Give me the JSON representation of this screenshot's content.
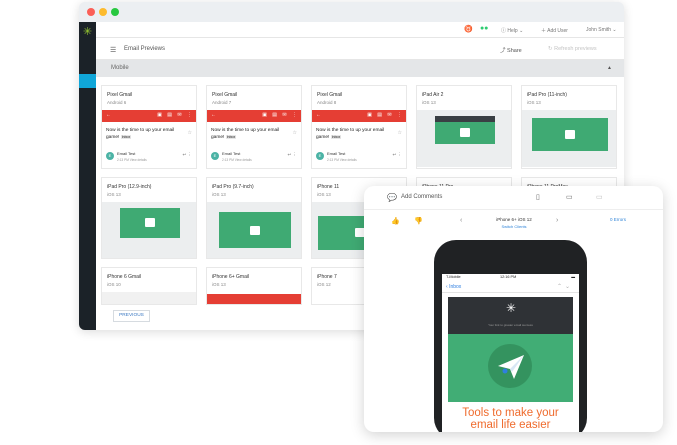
{
  "topbar": {
    "help": "Help",
    "add_user": "Add User",
    "user": "John Smith"
  },
  "header": {
    "title": "Email Previews",
    "share": "Share",
    "refresh": "Refresh previews"
  },
  "section": {
    "label": "Mobile"
  },
  "gmail": {
    "subject": "Now is the time to up your email game!",
    "inbox_tag": "Inbox",
    "from": "Email Test",
    "meta": "2:13 PM View details",
    "avatar_letter": "E"
  },
  "cards": [
    {
      "name": "Pixel Gmail",
      "os": "Android 6"
    },
    {
      "name": "Pixel Gmail",
      "os": "Android 7"
    },
    {
      "name": "Pixel Gmail",
      "os": "Android 8"
    },
    {
      "name": "iPad Air 2",
      "os": "iOS 13"
    },
    {
      "name": "iPad Pro (11-inch)",
      "os": "iOS 13"
    },
    {
      "name": "iPad Pro (12.9-inch)",
      "os": "iOS 13"
    },
    {
      "name": "iPad Pro (9.7-inch)",
      "os": "iOS 13"
    },
    {
      "name": "iPhone 11",
      "os": "iOS 13"
    },
    {
      "name": "iPhone 11 Pro",
      "os": ""
    },
    {
      "name": "iPhone 11 ProMax",
      "os": ""
    },
    {
      "name": "iPhone 6 Gmail",
      "os": "iOS 10"
    },
    {
      "name": "iPhone 6+ Gmail",
      "os": "iOS 13"
    },
    {
      "name": "iPhone 7",
      "os": "iOS 12"
    }
  ],
  "pagination": {
    "previous": "PREVIOUS"
  },
  "panel": {
    "add_comments": "Add Comments",
    "device": "iPhone 6+ iOS 12",
    "switch_clients": "Switch Clients",
    "errors": "0 Errors",
    "status": {
      "carrier": "T-Mobile",
      "time": "12:16 PM"
    },
    "nav": {
      "inbox": "Inbox"
    },
    "email_dark_text": "Your link to greater email success",
    "headline": "Tools to make your email life easier"
  },
  "colors": {
    "gmail_red": "#e53e34",
    "brand_green": "#41ad75",
    "accent_blue": "#2f84d8",
    "headline_orange": "#ef6b2d",
    "sidebar": "#1b2228"
  }
}
